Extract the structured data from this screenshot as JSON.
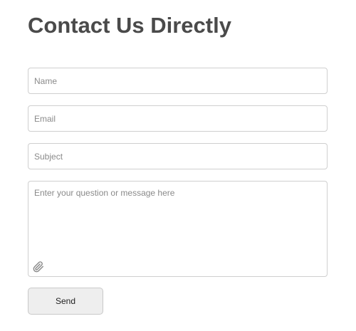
{
  "page": {
    "title": "Contact Us Directly"
  },
  "form": {
    "name": {
      "placeholder": "Name",
      "value": ""
    },
    "email": {
      "placeholder": "Email",
      "value": ""
    },
    "subject": {
      "placeholder": "Subject",
      "value": ""
    },
    "message": {
      "placeholder": "Enter your question or message here",
      "value": "",
      "attachment_icon": "paperclip-icon"
    },
    "send_label": "Send"
  },
  "colors": {
    "title": "#4a4a4a",
    "field_border": "#cfcfcf",
    "placeholder": "#8a8a8a",
    "button_bg": "#eeeeee",
    "button_border": "#c9c9c9"
  }
}
